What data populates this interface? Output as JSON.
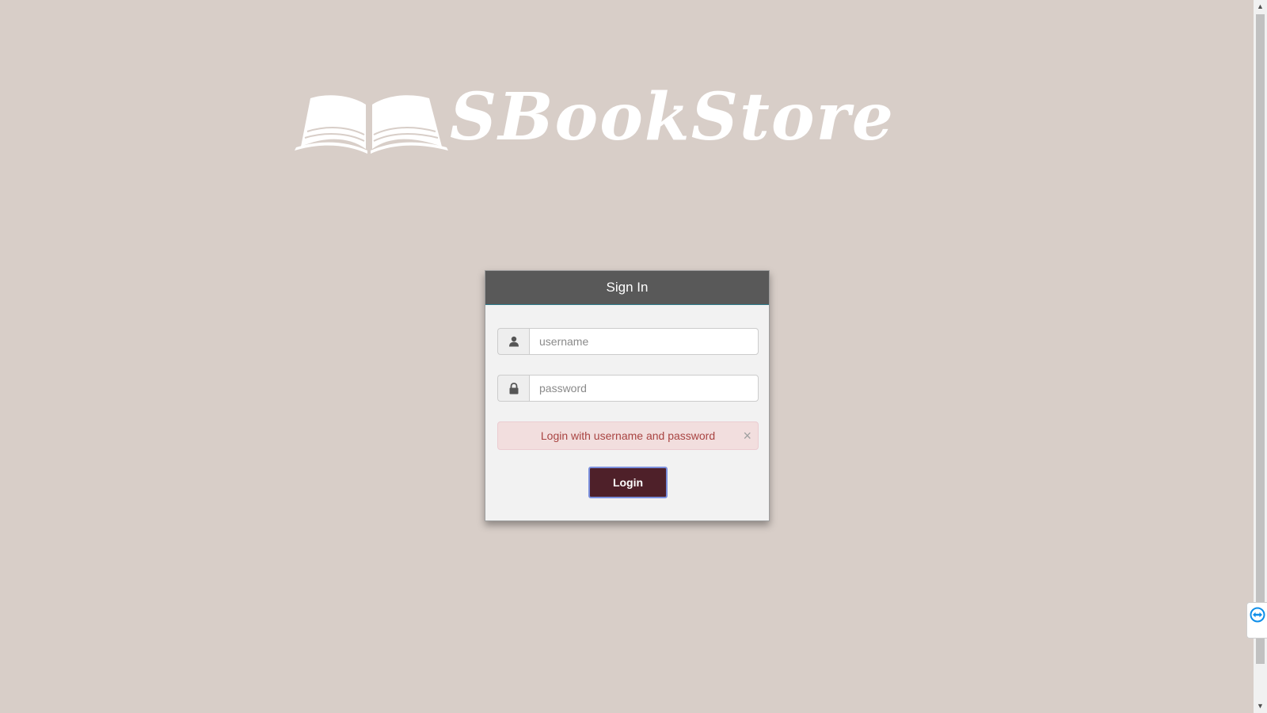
{
  "logo": {
    "text": "SBookStore"
  },
  "signin": {
    "title": "Sign In",
    "username_placeholder": "username",
    "password_placeholder": "password",
    "username_value": "",
    "password_value": "",
    "alert_message": "Login with username and password",
    "alert_close": "×",
    "login_label": "Login"
  },
  "icons": {
    "user": "user-icon",
    "lock": "lock-icon",
    "book": "open-book-icon",
    "remote": "teamviewer-icon"
  },
  "colors": {
    "background": "#d8cec8",
    "header": "#595959",
    "button": "#4e2029",
    "alert_bg": "#f2dede",
    "alert_text": "#a94442"
  }
}
